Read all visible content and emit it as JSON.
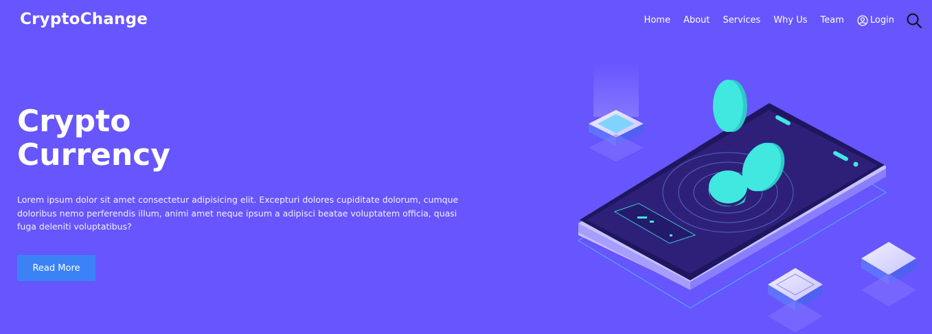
{
  "header": {
    "brand": "CryptoChange",
    "nav": {
      "home": "Home",
      "about": "About",
      "services": "Services",
      "why_us": "Why Us",
      "team": "Team",
      "login": "Login"
    },
    "icons": {
      "login": "user-circle-icon",
      "search": "search-icon"
    }
  },
  "hero": {
    "title_line1": "Crypto",
    "title_line2": "Currency",
    "description": "Lorem ipsum dolor sit amet consectetur adipisicing elit. Excepturi dolores cupiditate dolorum, cumque doloribus nemo perferendis illum, animi amet neque ipsum a adipisci beatae voluptatem officia, quasi fuga deleniti voluptatibus?",
    "button": "Read More"
  },
  "colors": {
    "background": "#6755fe",
    "button": "#3b82f6",
    "accent": "#40e8e0",
    "phone_screen": "#2e2079"
  }
}
